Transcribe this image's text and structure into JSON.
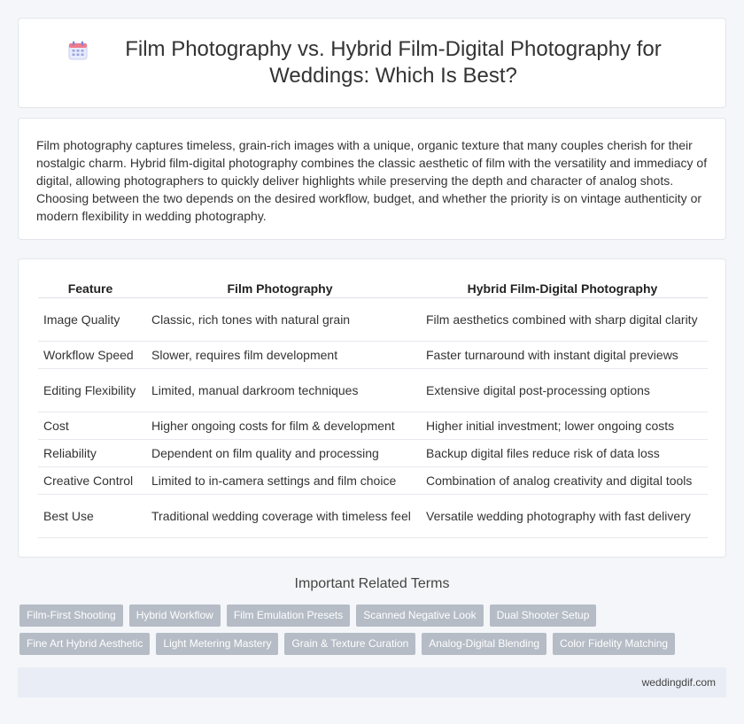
{
  "header": {
    "title": "Film Photography vs. Hybrid Film-Digital Photography for Weddings: Which Is Best?",
    "icon": "calendar-icon"
  },
  "intro": {
    "text": "Film photography captures timeless, grain-rich images with a unique, organic texture that many couples cherish for their nostalgic charm. Hybrid film-digital photography combines the classic aesthetic of film with the versatility and immediacy of digital, allowing photographers to quickly deliver highlights while preserving the depth and character of analog shots. Choosing between the two depends on the desired workflow, budget, and whether the priority is on vintage authenticity or modern flexibility in wedding photography."
  },
  "table": {
    "headers": [
      "Feature",
      "Film Photography",
      "Hybrid Film-Digital Photography"
    ],
    "rows": [
      [
        "Image Quality",
        "Classic, rich tones with natural grain",
        "Film aesthetics combined with sharp digital clarity"
      ],
      [
        "Workflow Speed",
        "Slower, requires film development",
        "Faster turnaround with instant digital previews"
      ],
      [
        "Editing Flexibility",
        "Limited, manual darkroom techniques",
        "Extensive digital post-processing options"
      ],
      [
        "Cost",
        "Higher ongoing costs for film & development",
        "Higher initial investment; lower ongoing costs"
      ],
      [
        "Reliability",
        "Dependent on film quality and processing",
        "Backup digital files reduce risk of data loss"
      ],
      [
        "Creative Control",
        "Limited to in-camera settings and film choice",
        "Combination of analog creativity and digital tools"
      ],
      [
        "Best Use",
        "Traditional wedding coverage with timeless feel",
        "Versatile wedding photography with fast delivery"
      ]
    ]
  },
  "related": {
    "title": "Important Related Terms",
    "row1": [
      "Film-First Shooting",
      "Hybrid Workflow",
      "Film Emulation Presets",
      "Scanned Negative Look",
      "Dual Shooter Setup"
    ],
    "row2": [
      "Fine Art Hybrid Aesthetic",
      "Light Metering Mastery",
      "Grain & Texture Curation",
      "Analog-Digital Blending",
      "Color Fidelity Matching"
    ]
  },
  "footer": {
    "site": "weddingdif.com"
  }
}
